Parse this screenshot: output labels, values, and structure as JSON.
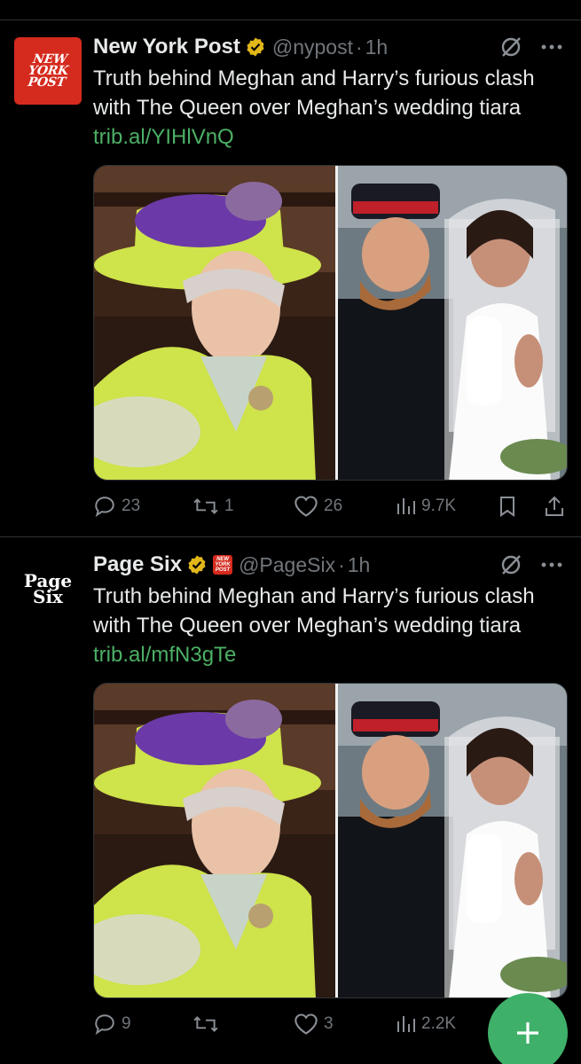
{
  "tweets": [
    {
      "avatar_text": [
        "NEW",
        "YORK",
        "POST"
      ],
      "name": "New York Post",
      "handle": "@nypost",
      "separator": "·",
      "time": "1h",
      "text": "Truth behind Meghan and Harry’s furious clash with The Queen over Meghan’s wedding tiara",
      "link": "trib.al/YIHlVnQ",
      "stats": {
        "replies": "23",
        "retweets": "1",
        "likes": "26",
        "views": "9.7K"
      }
    },
    {
      "avatar_text": [
        "Page",
        "Six"
      ],
      "name": "Page Six",
      "affiliate_badge_text": [
        "NEW",
        "YORK",
        "POST"
      ],
      "handle": "@PageSix",
      "separator": "·",
      "time": "1h",
      "text": "Truth behind Meghan and Harry’s furious clash with The Queen over Meghan’s wedding tiara",
      "link": "trib.al/mfN3gTe",
      "stats": {
        "replies": "9",
        "retweets": "",
        "likes": "3",
        "views": "2.2K"
      }
    }
  ],
  "colors": {
    "verified_gold": "#e2b719",
    "link_green": "#4caf65",
    "fab_green": "#3fb06a",
    "muted": "#71767b"
  },
  "icons": [
    "reply-icon",
    "retweet-icon",
    "like-icon",
    "views-icon",
    "bookmark-icon",
    "share-icon",
    "grok-icon",
    "more-icon",
    "compose-icon"
  ]
}
